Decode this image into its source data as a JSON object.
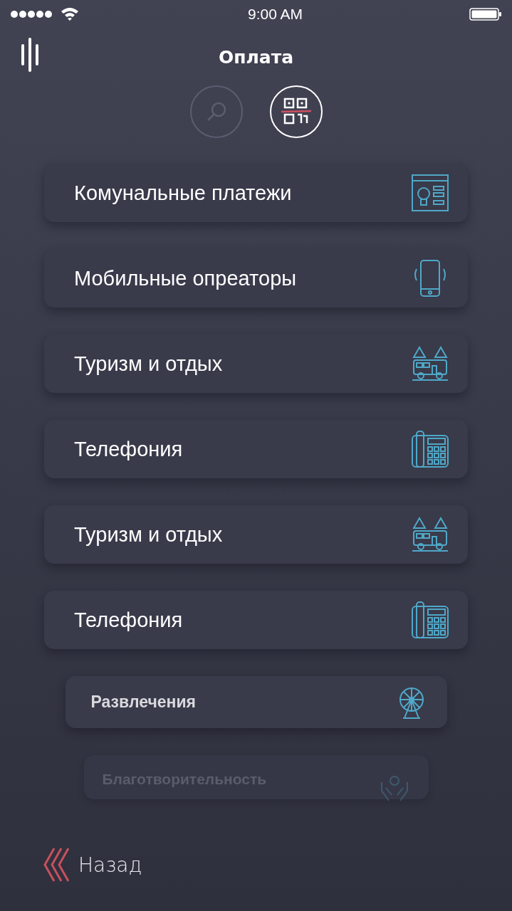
{
  "status_bar": {
    "time": "9:00 AM"
  },
  "header": {
    "title": "Оплата"
  },
  "modes": [
    {
      "kind": "search",
      "selected": false
    },
    {
      "kind": "qr",
      "selected": true
    }
  ],
  "categories": [
    {
      "label": "Комунальные платежи",
      "kind": "full"
    },
    {
      "label": "Мобильные опреаторы",
      "kind": "full"
    },
    {
      "label": "Туризм и отдых",
      "kind": "full"
    },
    {
      "label": "Телефония",
      "kind": "full"
    },
    {
      "label": "Туризм и отдых",
      "kind": "full"
    },
    {
      "label": "Телефония",
      "kind": "full"
    },
    {
      "label": "Развлечения",
      "kind": "compact"
    },
    {
      "label": "Благотворительность",
      "kind": "faded"
    }
  ],
  "back": {
    "label": "Назад"
  }
}
